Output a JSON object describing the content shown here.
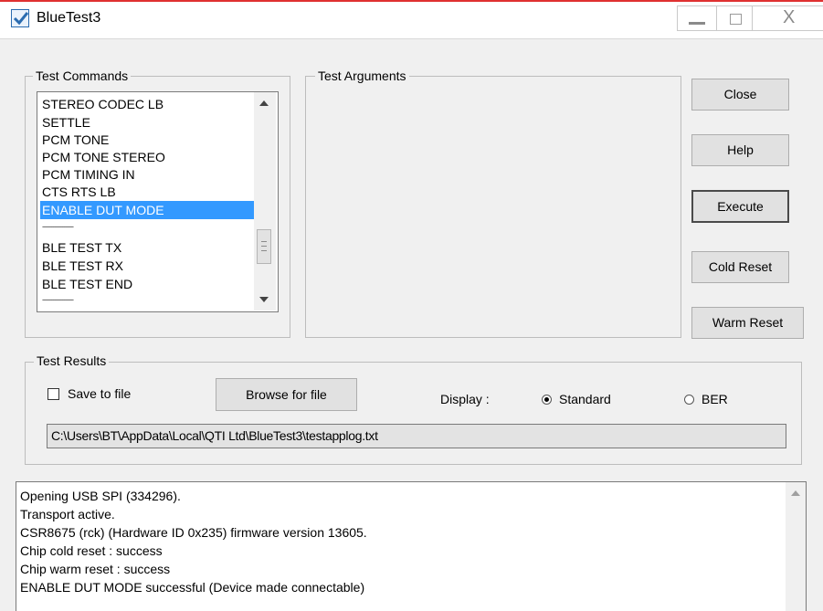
{
  "window": {
    "title": "BlueTest3",
    "close_glyph": "X"
  },
  "test_commands": {
    "label": "Test Commands",
    "items": [
      {
        "label": "STEREO CODEC LB"
      },
      {
        "label": "SETTLE"
      },
      {
        "label": "PCM TONE"
      },
      {
        "label": "PCM TONE STEREO"
      },
      {
        "label": "PCM TIMING IN"
      },
      {
        "label": "CTS RTS LB"
      },
      {
        "label": "ENABLE DUT MODE",
        "selected": true
      },
      {
        "label": "-----------------"
      },
      {
        "label": "BLE TEST TX"
      },
      {
        "label": "BLE TEST RX"
      },
      {
        "label": "BLE TEST END"
      },
      {
        "label": "-----------------"
      }
    ]
  },
  "test_arguments": {
    "label": "Test Arguments"
  },
  "buttons": {
    "close": "Close",
    "help": "Help",
    "execute": "Execute",
    "cold_reset": "Cold Reset",
    "warm_reset": "Warm Reset"
  },
  "test_results": {
    "label": "Test Results",
    "save_to_file": {
      "label": "Save to file",
      "checked": false
    },
    "browse_button": "Browse for file",
    "display_label": "Display :",
    "display_options": [
      {
        "label": "Standard",
        "checked": true
      },
      {
        "label": "BER",
        "checked": false
      }
    ],
    "file_path": "C:\\Users\\BT\\AppData\\Local\\QTI Ltd\\BlueTest3\\testapplog.txt"
  },
  "log": {
    "lines": [
      "Opening USB SPI (334296).",
      "Transport active.",
      "CSR8675 (rck) (Hardware ID 0x235) firmware version 13605.",
      "Chip cold reset : success",
      "Chip warm reset : success",
      "ENABLE DUT MODE successful (Device made connectable)"
    ]
  },
  "colors": {
    "selection": "#3399ff",
    "title_accent": "#e03131",
    "window_bg": "#f0f0f0"
  }
}
